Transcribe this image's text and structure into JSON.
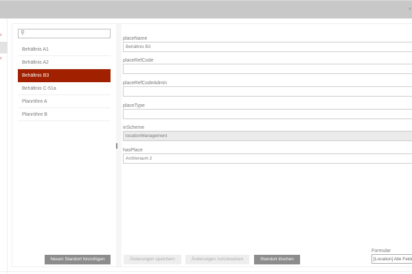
{
  "window": {
    "close_icon": "close-icon"
  },
  "leftnav": {
    "icons": [
      "chevron-right-icon",
      "chevron-right-icon"
    ]
  },
  "list": {
    "search": {
      "placeholder": "",
      "icon": "search-icon"
    },
    "items": [
      "Behältnis A1",
      "Behältnis A2",
      "Behältnis B3",
      "Behältnis C-51a",
      "Planröhre A",
      "Planröhre B"
    ],
    "selected": "Behältnis B3",
    "selected_color": "#a02000",
    "add_button": "Neuen Standort hinzufügen"
  },
  "form": {
    "fields": [
      {
        "label": "placeName",
        "value": "Behältnis B3"
      },
      {
        "label": "placeRefCode",
        "value": ""
      },
      {
        "label": "placeRefCodeAdmin",
        "value": ""
      },
      {
        "label": "placeType",
        "value": ""
      },
      {
        "label": "inScheme",
        "value": "locationManagement"
      },
      {
        "label": "hasPlace",
        "value": "Archivraum 2"
      }
    ],
    "save_button": "Änderungen speichern",
    "reset_button": "Änderungen zurücksetzen",
    "delete_button": "Standort löschen",
    "formular_label": "Formular",
    "formular_value": "[Location] Alle Felder"
  }
}
